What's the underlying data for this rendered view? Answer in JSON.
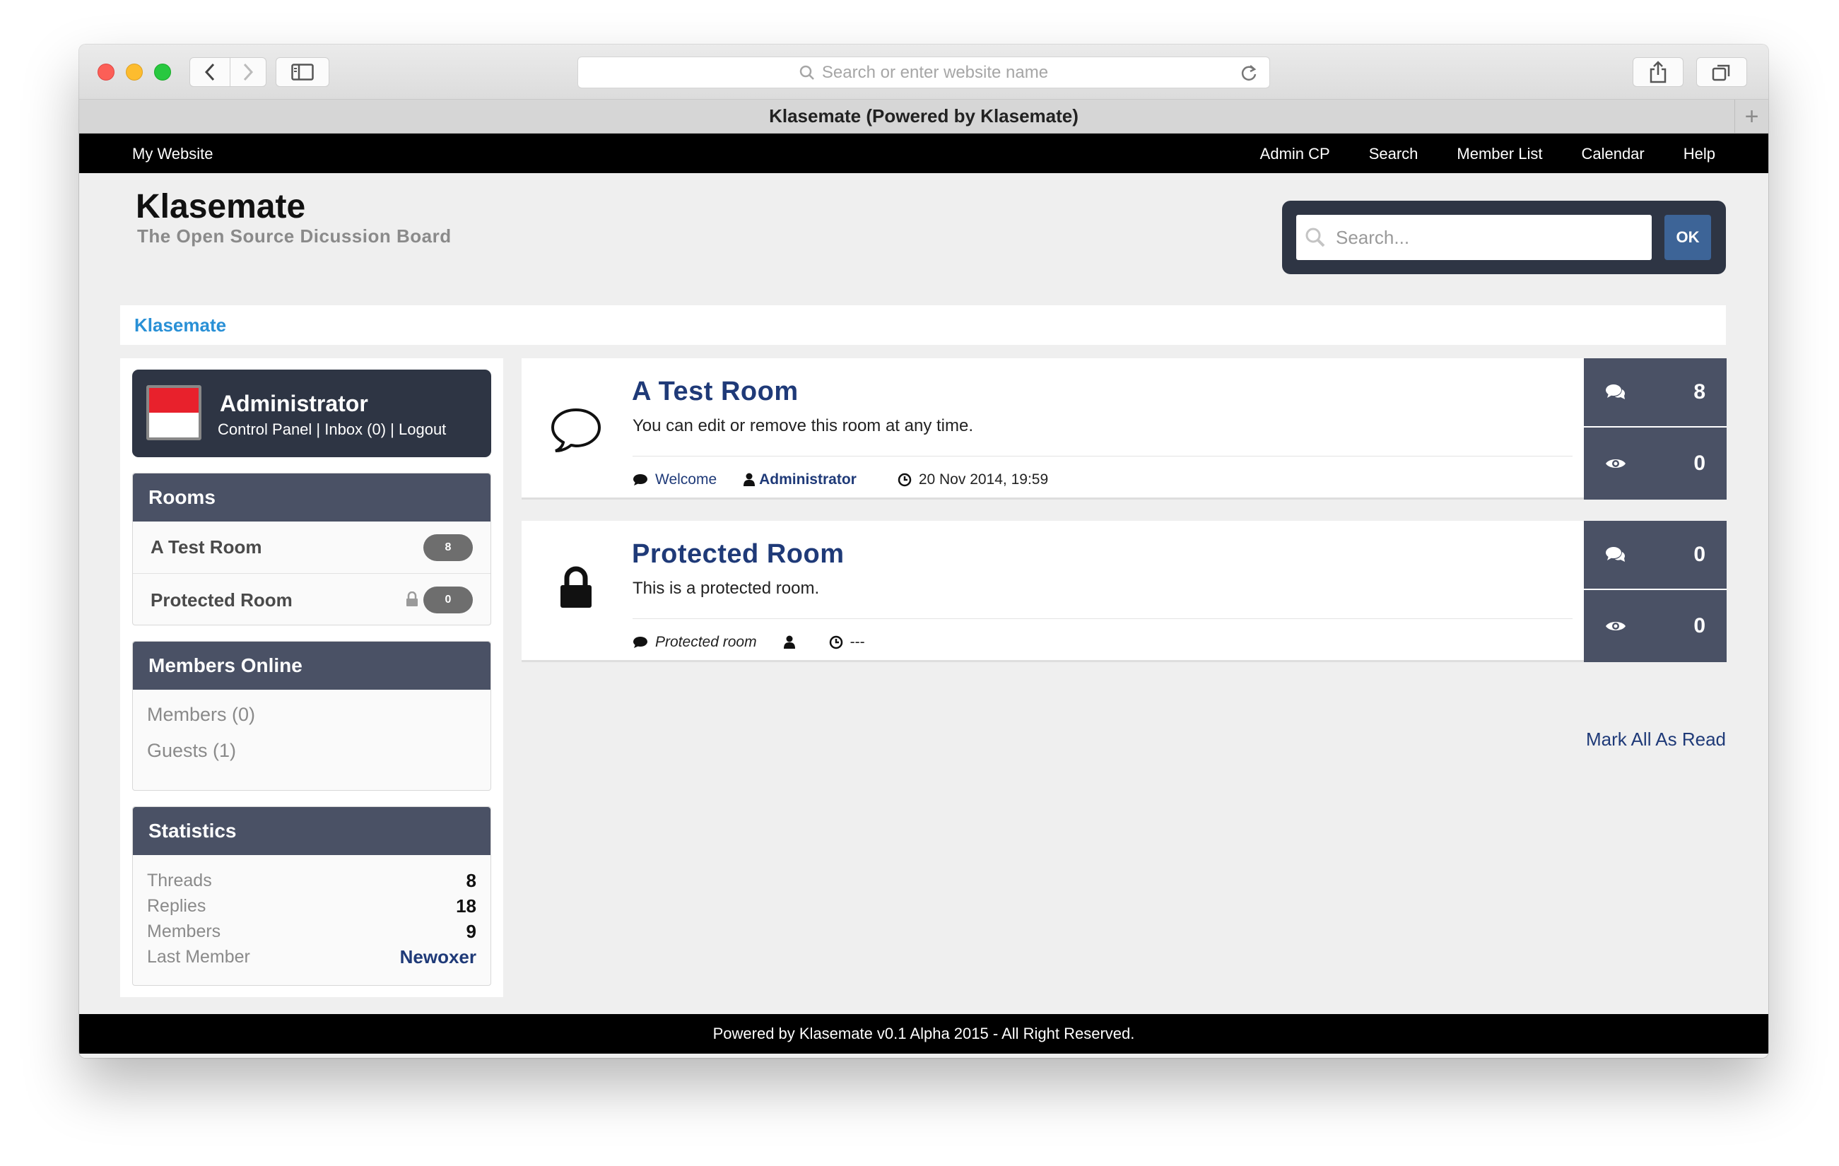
{
  "browser": {
    "url_placeholder": "Search or enter website name",
    "tab_title": "Klasemate (Powered by Klasemate)",
    "new_tab": "+"
  },
  "nav": {
    "brand": "My Website",
    "links": [
      "Admin CP",
      "Search",
      "Member List",
      "Calendar",
      "Help"
    ]
  },
  "header": {
    "title": "Klasemate",
    "subtitle": "The Open Source Dicussion Board",
    "search_placeholder": "Search...",
    "search_button": "OK"
  },
  "breadcrumb": "Klasemate",
  "user": {
    "name": "Administrator",
    "links": "Control Panel | Inbox (0) | Logout"
  },
  "rooms_panel": {
    "title": "Rooms",
    "items": [
      {
        "label": "A Test Room",
        "count": "8",
        "locked": false
      },
      {
        "label": "Protected Room",
        "count": "0",
        "locked": true
      }
    ]
  },
  "online_panel": {
    "title": "Members Online",
    "members": "Members (0)",
    "guests": "Guests (1)"
  },
  "stats_panel": {
    "title": "Statistics",
    "rows": [
      {
        "label": "Threads",
        "value": "8"
      },
      {
        "label": "Replies",
        "value": "18"
      },
      {
        "label": "Members",
        "value": "9"
      },
      {
        "label": "Last Member",
        "value": "Newoxer"
      }
    ]
  },
  "rooms": [
    {
      "title": "A Test Room",
      "description": "You can edit or remove this room at any time.",
      "last_thread": "Welcome",
      "last_author": "Administrator",
      "last_date": "20 Nov 2014, 19:59",
      "threads": "8",
      "views": "0",
      "icon": "speech-bubble-icon"
    },
    {
      "title": "Protected Room",
      "description": "This is a protected room.",
      "last_thread": "Protected room",
      "last_author": "",
      "last_date": "---",
      "threads": "0",
      "views": "0",
      "icon": "lock-icon"
    }
  ],
  "mark_all_read": "Mark All As Read",
  "footer": "Powered by Klasemate v0.1 Alpha 2015 - All Right Reserved.",
  "colors": {
    "dark_panel": "#2e3544",
    "panel_head": "#4a5165",
    "title_blue": "#1f3a78",
    "breadcrumb_blue": "#2990d6",
    "ok_button": "#3d6497"
  }
}
